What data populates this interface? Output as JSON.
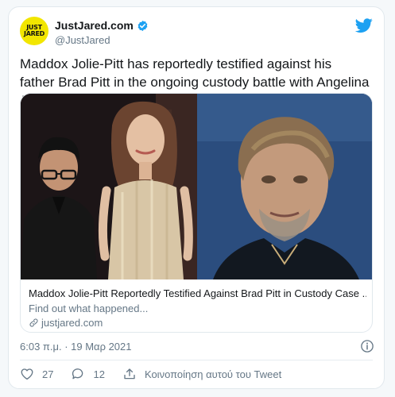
{
  "account": {
    "display_name": "JustJared.com",
    "handle": "@JustJared",
    "avatar_text_line1": "JUST",
    "avatar_text_line2": "JARED"
  },
  "tweet": {
    "text": "Maddox Jolie-Pitt has reportedly testified against his father Brad Pitt in the ongoing custody battle with Angelina Jolie",
    "timestamp": "6:03 π.μ. · 19 Μαρ 2021"
  },
  "card": {
    "title": "Maddox Jolie-Pitt Reportedly Testified Against Brad Pitt in Custody Case ...",
    "description": "Find out what happened...",
    "domain": "justjared.com"
  },
  "actions": {
    "likes_count": "27",
    "replies_count": "12",
    "share_label": "Κοινοποίηση αυτού του Tweet"
  },
  "colors": {
    "twitter_blue": "#1da1f2",
    "avatar_yellow": "#f2e600",
    "secondary_text": "#657786"
  }
}
